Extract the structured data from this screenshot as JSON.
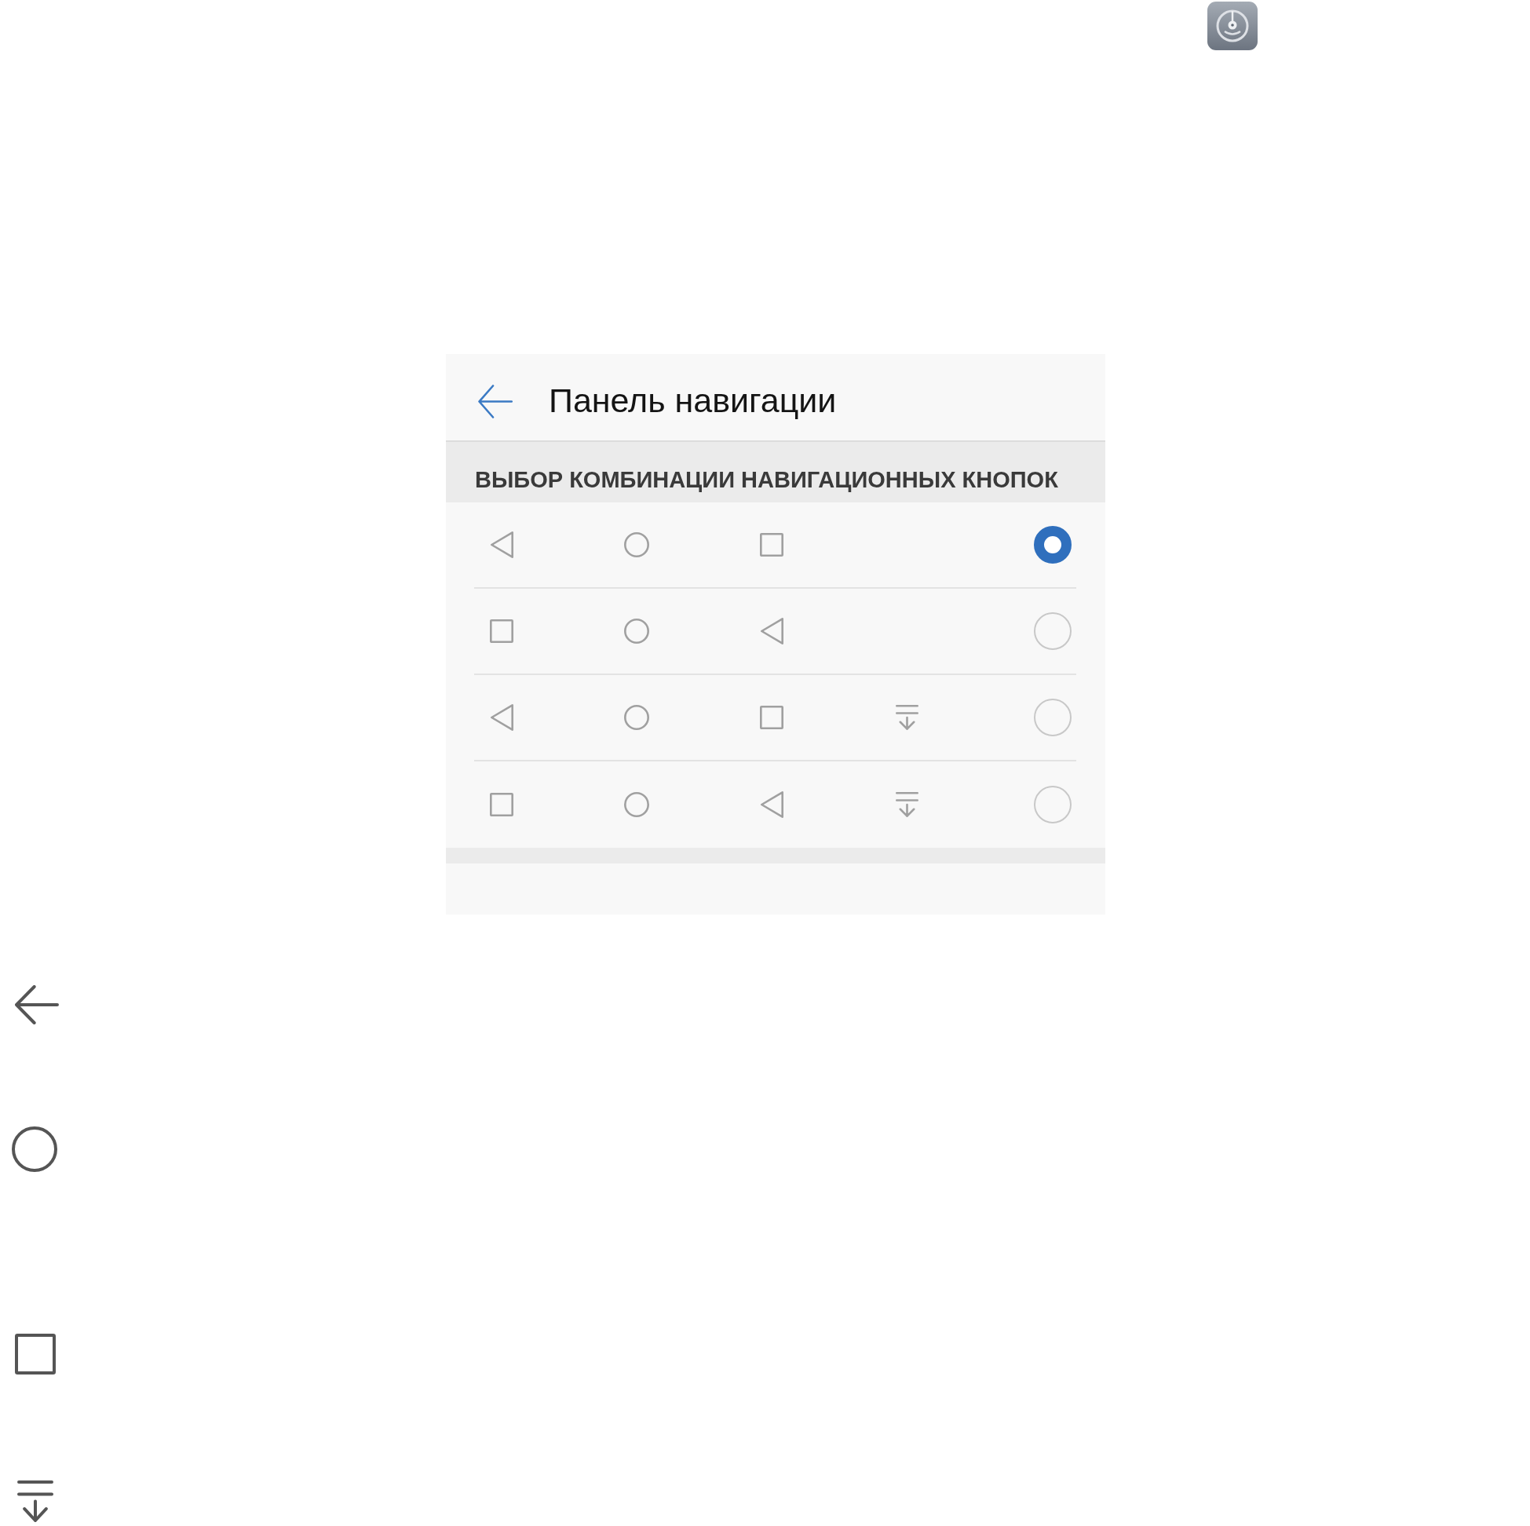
{
  "header": {
    "title": "Панель навигации"
  },
  "section": {
    "title": "ВЫБОР КОМБИНАЦИИ НАВИГАЦИОННЫХ КНОПОК"
  },
  "rows": [
    {
      "selected": true,
      "buttons": [
        {
          "kind": "triangle"
        },
        {
          "kind": "circle"
        },
        {
          "kind": "square"
        }
      ]
    },
    {
      "selected": false,
      "buttons": [
        {
          "kind": "square"
        },
        {
          "kind": "circle"
        },
        {
          "kind": "triangle"
        }
      ]
    },
    {
      "selected": false,
      "buttons": [
        {
          "kind": "triangle"
        },
        {
          "kind": "circle"
        },
        {
          "kind": "square"
        },
        {
          "kind": "pulldown"
        }
      ]
    },
    {
      "selected": false,
      "buttons": [
        {
          "kind": "square"
        },
        {
          "kind": "circle"
        },
        {
          "kind": "triangle"
        },
        {
          "kind": "pulldown"
        }
      ]
    }
  ],
  "legend": [
    {
      "kind": "arrow"
    },
    {
      "kind": "circle"
    },
    {
      "kind": "square"
    },
    {
      "kind": "pulldown"
    }
  ]
}
